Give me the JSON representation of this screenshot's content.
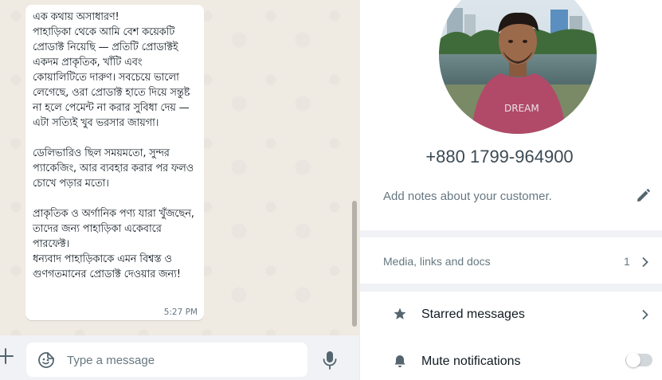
{
  "chat": {
    "message_text": "এক কথায় অসাধারণ!\nপাহাড়িকা থেকে আমি বেশ কয়েকটি প্রোডাক্ট নিয়েছি — প্রতিটি প্রোডাক্টই একদম প্রাকৃতিক, খাঁটি এবং কোয়ালিটিতে দারুণ। সবচেয়ে ভালো লেগেছে, ওরা প্রোডাক্ট হাতে দিয়ে সন্তুষ্ট না হলে পেমেন্ট না করার সুবিধা দেয় — এটা সত্যিই খুব ভরসার জায়গা।\n\nডেলিভারিও ছিল সময়মতো, সুন্দর প্যাকেজিং, আর ব্যবহার করার পর ফলও চোখে পড়ার মতো।\n\nপ্রাকৃতিক ও অর্গানিক পণ্য যারা খুঁজছেন, তাদের জন্য পাহাড়িকা একেবারে পারফেক্ট।\nধন্যবাদ পাহাড়িকাকে এমন বিশ্বস্ত ও গুণগতমানের প্রোডাক্ট দেওয়ার জন্য!",
    "message_time": "5:27 PM"
  },
  "compose": {
    "placeholder": "Type a message",
    "value": ""
  },
  "contact": {
    "phone": "+880 1799-964900",
    "notes_placeholder": "Add notes about your customer.",
    "media_label": "Media, links and docs",
    "media_count": "1",
    "starred_label": "Starred messages",
    "mute_label": "Mute notifications",
    "mute_on": false
  },
  "icons": {
    "attach": "plus-icon",
    "sticker": "sticker-icon",
    "mic": "mic-icon",
    "edit": "pencil-icon",
    "starred": "star-icon",
    "mute": "bell-icon"
  },
  "colors": {
    "chat_background": "#efeae2",
    "panel_background": "#f0f2f5",
    "icon_gray": "#54656f",
    "secondary_text": "#667781"
  }
}
